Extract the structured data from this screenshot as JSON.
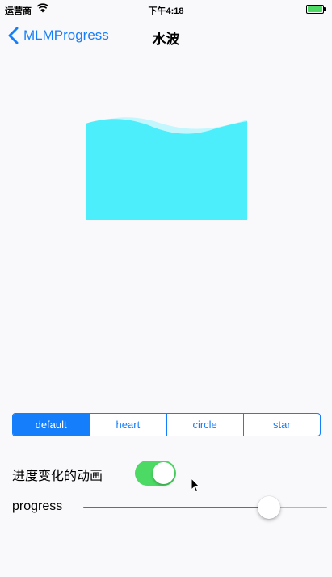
{
  "status_bar": {
    "carrier": "运营商",
    "time": "下午4:18",
    "wifi_icon": "wifi-icon",
    "battery_icon": "battery-icon",
    "battery_color": "#4cd964"
  },
  "nav": {
    "back_label": "MLMProgress",
    "back_icon": "chevron-left-icon",
    "title": "水波"
  },
  "wave": {
    "front_color": "#4deefb",
    "back_color": "#c3f7fd",
    "progress": 0.8
  },
  "segments": {
    "items": [
      "default",
      "heart",
      "circle",
      "star"
    ],
    "selected_index": 0,
    "accent_color": "#157efb"
  },
  "animation_toggle": {
    "label": "进度变化的动画",
    "on": true,
    "on_color": "#4cd964"
  },
  "progress_slider": {
    "label": "progress",
    "value": 0.76
  },
  "pointer": {
    "icon": "mouse-cursor-icon"
  }
}
